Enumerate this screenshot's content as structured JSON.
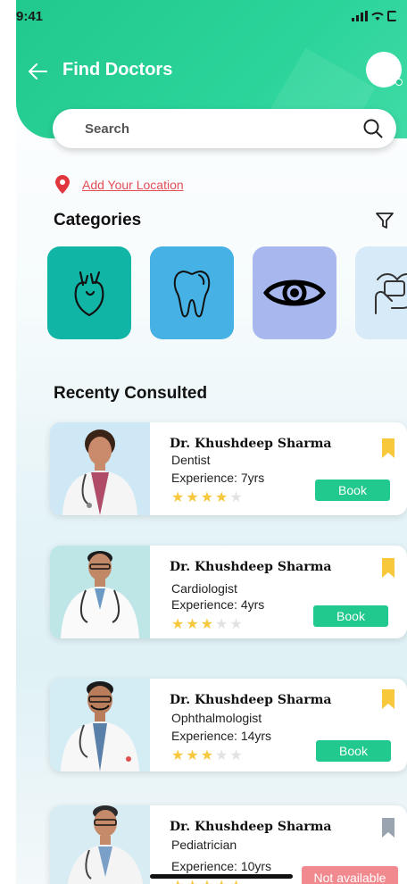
{
  "status": {
    "time": "9:41"
  },
  "header": {
    "title": "Find Doctors"
  },
  "search": {
    "placeholder": "Search"
  },
  "location": {
    "label": "Add Your Location"
  },
  "categories": {
    "title": "Categories",
    "items": [
      {
        "icon": "heart-icon",
        "color": "#11b5a6"
      },
      {
        "icon": "tooth-icon",
        "color": "#45b1e5"
      },
      {
        "icon": "eye-icon",
        "color": "#a8b8ef"
      },
      {
        "icon": "hand-care-icon",
        "color": "#d7eaf7"
      }
    ]
  },
  "recent": {
    "title": "Recenty Consulted",
    "doctors": [
      {
        "name": "Dr. Khushdeep Sharma",
        "specialty": "Dentist",
        "experience": "Experience: 7yrs",
        "rating": 4,
        "bookmark_color": "#f7c73c",
        "action": "Book"
      },
      {
        "name": "Dr. Khushdeep Sharma",
        "specialty": "Cardiologist",
        "experience": "Experience: 4yrs",
        "rating": 3,
        "bookmark_color": "#f7c73c",
        "action": "Book"
      },
      {
        "name": "Dr. Khushdeep Sharma",
        "specialty": "Ophthalmologist",
        "experience": "Experience: 14yrs",
        "rating": 3,
        "bookmark_color": "#f7c73c",
        "action": "Book"
      },
      {
        "name": "Dr. Khushdeep Sharma",
        "specialty": "Pediatrician",
        "experience": "Experience: 10yrs",
        "rating": 5,
        "bookmark_color": "#9aa3b0",
        "action": "Not available"
      }
    ]
  },
  "colors": {
    "primary": "#22c98e",
    "danger": "#e44d56",
    "star": "#f7c73c"
  }
}
